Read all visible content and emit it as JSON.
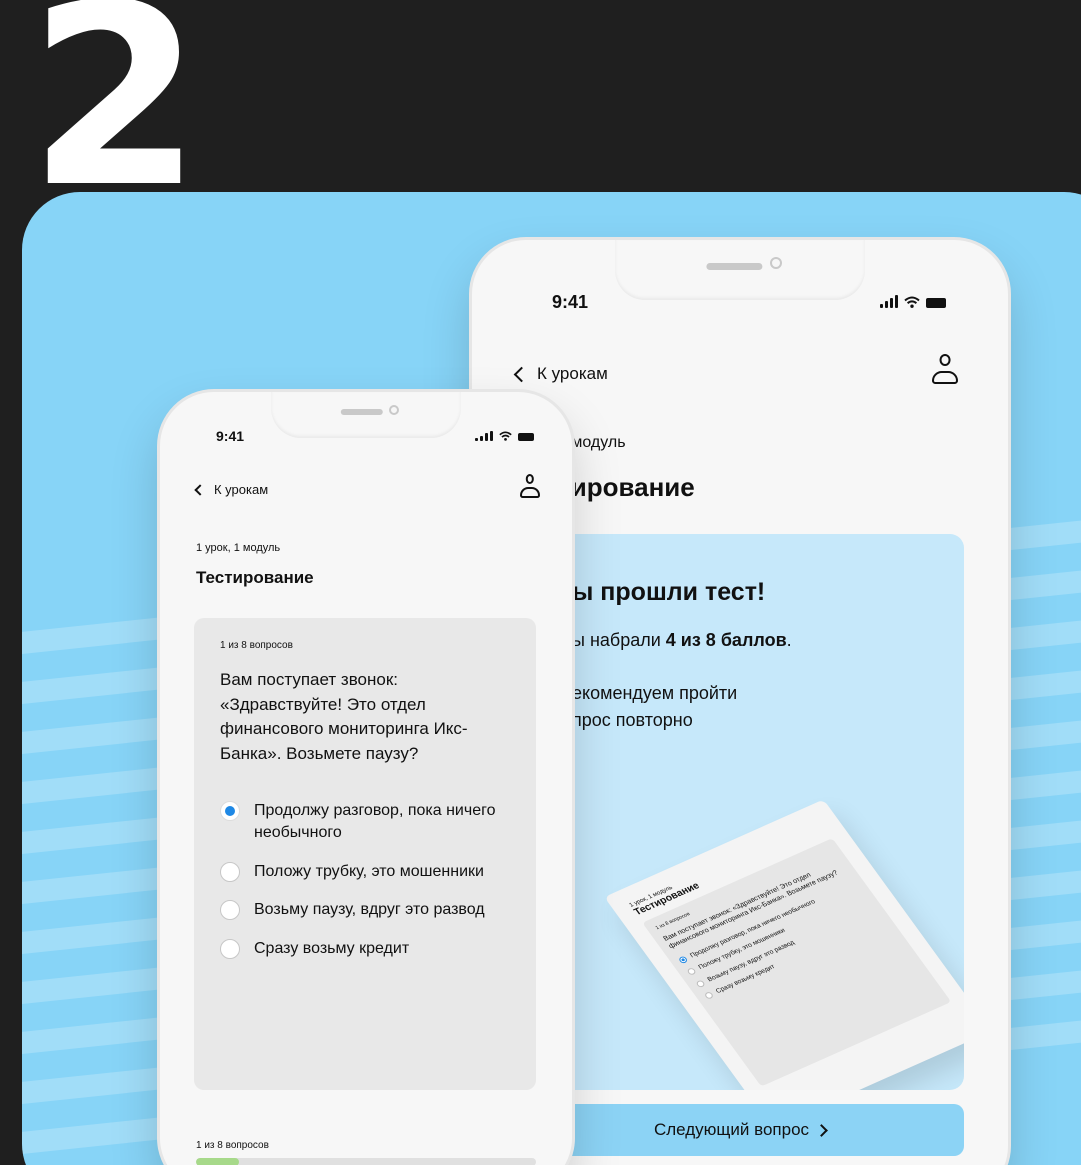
{
  "step_number": "2",
  "back_phone": {
    "status": {
      "time": "9:41"
    },
    "nav": {
      "back_label": "К урокам"
    },
    "subtitle": "1 модуль",
    "title": "тирование",
    "result": {
      "headline": "ы прошли тест!",
      "score_prefix": "ы набрали ",
      "score_value": "4 из 8 баллов",
      "score_suffix": ".",
      "recommendation": "екомендуем пройти\nпрос повторно"
    },
    "illustration": {
      "subtitle": "1 урок, 1 модуль",
      "title": "Тестирование",
      "count": "1 из 8 вопросов",
      "question": "Вам поступает звонок: «Здравствуйте! Это отдел финансового мониторинга Икс-Банка». Возьмете паузу?",
      "options": [
        "Продолжу разговор, пока ничего необычного",
        "Положу трубку, это мошенники",
        "Возьму паузу, вдруг это развод",
        "Сразу возьму кредит"
      ]
    },
    "next_button": "Следующий вопрос"
  },
  "front_phone": {
    "status": {
      "time": "9:41"
    },
    "nav": {
      "back_label": "К урокам"
    },
    "subtitle": "1 урок, 1 модуль",
    "title": "Тестирование",
    "quiz": {
      "count": "1 из 8 вопросов",
      "question": "Вам поступает звонок: «Здравствуйте! Это отдел финансового мониторинга Икс-Банка». Возьмете паузу?",
      "options": [
        "Продолжу разговор, пока ничего необычного",
        "Положу трубку, это мошенники",
        "Возьму паузу, вдруг это развод",
        "Сразу возьму кредит"
      ],
      "selected_index": 0
    },
    "progress": {
      "label": "1 из 8 вопросов",
      "fraction": 0.125
    }
  },
  "colors": {
    "page_bg": "#1f1f1f",
    "stage_bg": "#87d4f7",
    "accent": "#1e88e5",
    "button_bg": "#8cd3f5",
    "progress_fill": "#a7d98a"
  }
}
